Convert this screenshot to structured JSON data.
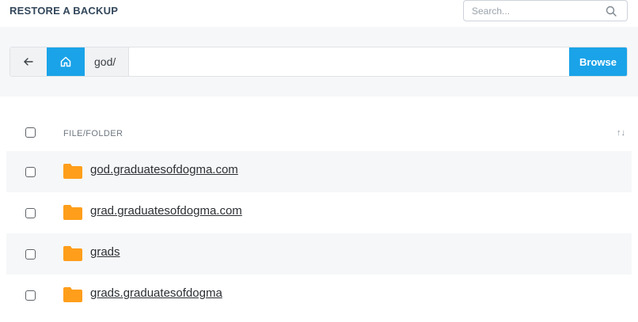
{
  "header": {
    "title": "RESTORE A BACKUP",
    "search_placeholder": "Search...",
    "search_icon": "search-icon"
  },
  "pathbar": {
    "back_icon": "arrow-left-icon",
    "home_icon": "home-icon",
    "prefix": "god/",
    "path_value": "",
    "browse_label": "Browse"
  },
  "table": {
    "column_header": "FILE/FOLDER",
    "sort_glyph": "↑↓",
    "rows": [
      {
        "name": "god.graduatesofdogma.com"
      },
      {
        "name": "grad.graduatesofdogma.com"
      },
      {
        "name": "grads"
      },
      {
        "name": "grads.graduatesofdogma"
      }
    ]
  },
  "colors": {
    "accent": "#1aa3e8",
    "folder": "#ff9e1b",
    "row_stripe": "#f6f7f8"
  }
}
